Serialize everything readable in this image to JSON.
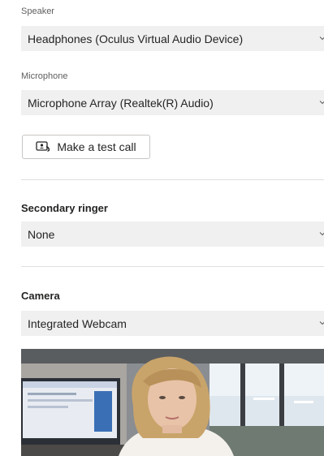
{
  "speaker": {
    "label": "Speaker",
    "selected": "Headphones (Oculus Virtual Audio Device)"
  },
  "microphone": {
    "label": "Microphone",
    "selected": "Microphone Array (Realtek(R) Audio)"
  },
  "test_call": {
    "label": "Make a test call",
    "icon": "test-call-icon"
  },
  "secondary_ringer": {
    "title": "Secondary ringer",
    "selected": "None"
  },
  "camera": {
    "title": "Camera",
    "selected": "Integrated Webcam",
    "preview_icon": "camera-preview-image"
  },
  "icons": {
    "dropdown": "chevron-down-icon"
  },
  "colors": {
    "select_bg": "#f0f0f0",
    "divider": "#e1dfdd",
    "text": "#252423",
    "label": "#605e5c"
  }
}
